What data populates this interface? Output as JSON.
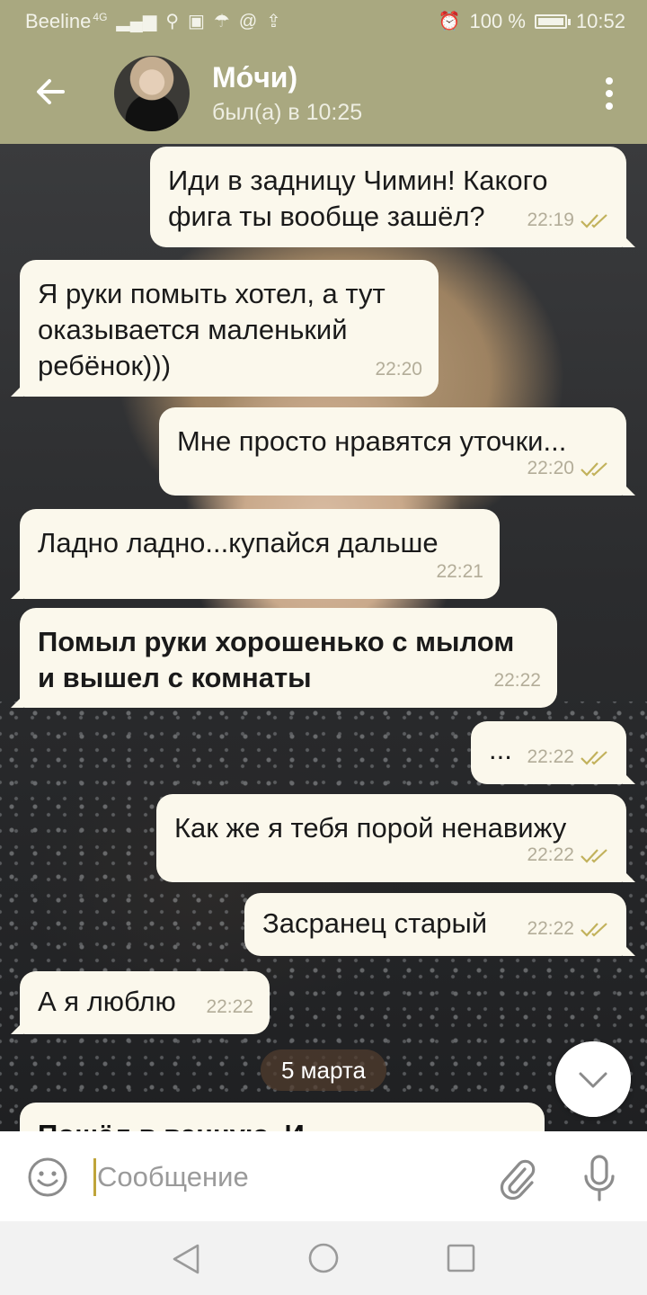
{
  "status_bar": {
    "carrier": "Beeline",
    "network": "4G",
    "battery": "100 %",
    "time": "10:52"
  },
  "header": {
    "contact_name": "Мо́чи)",
    "last_seen": "был(а) в 10:25"
  },
  "messages": [
    {
      "dir": "out",
      "text": "Иди в задницу Чимин! Какого\nфига ты вообще зашёл?",
      "time": "22:19",
      "read": true,
      "bold": false
    },
    {
      "dir": "in",
      "text": "Я руки помыть хотел, а тут\nоказывается маленький\nребёнок)))",
      "time": "22:20",
      "bold": false
    },
    {
      "dir": "out",
      "text": "Мне просто нравятся уточки...",
      "time": "22:20",
      "read": true,
      "bold": false
    },
    {
      "dir": "in",
      "text": "Ладно ладно...купайся дальше",
      "time": "22:21",
      "bold": false
    },
    {
      "dir": "in",
      "text": "Помыл руки хорошенько с мылом\nи вышел с комнаты",
      "time": "22:22",
      "bold": true
    },
    {
      "dir": "out",
      "text": "...",
      "time": "22:22",
      "read": true,
      "bold": false
    },
    {
      "dir": "out",
      "text": "Как же я тебя порой ненавижу",
      "time": "22:22",
      "read": true,
      "bold": false
    },
    {
      "dir": "out",
      "text": "Засранец старый",
      "time": "22:22",
      "read": true,
      "bold": false
    },
    {
      "dir": "in",
      "text": "А я люблю",
      "time": "22:22",
      "bold": false
    }
  ],
  "date_separator": "5 марта",
  "partial_message": "Пошёл в ванную. И ……",
  "input": {
    "placeholder": "Сообщение"
  },
  "colors": {
    "header_bg": "#a9a880",
    "bubble_bg": "#fbf8ec",
    "check_color": "#c2b25c"
  },
  "icons": {
    "back": "arrow-left-icon",
    "menu": "more-vertical-icon",
    "emoji": "smiley-icon",
    "attach": "paperclip-icon",
    "mic": "microphone-icon",
    "scroll": "chevron-down-icon"
  }
}
